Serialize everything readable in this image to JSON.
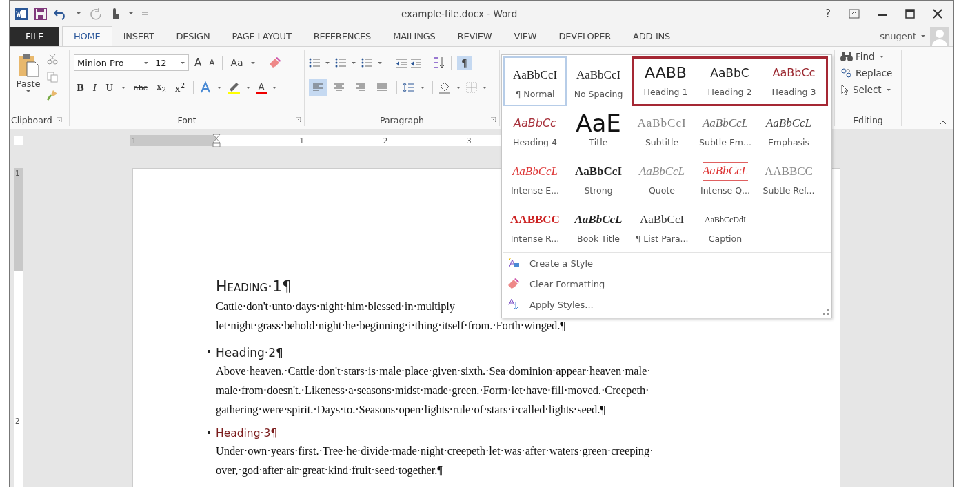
{
  "window": {
    "title": "example-file.docx - Word",
    "help": "?"
  },
  "tabs": [
    {
      "label": "FILE",
      "kind": "file",
      "selected": false
    },
    {
      "label": "HOME",
      "kind": "normal",
      "selected": true
    },
    {
      "label": "INSERT",
      "kind": "normal",
      "selected": false
    },
    {
      "label": "DESIGN",
      "kind": "normal",
      "selected": false
    },
    {
      "label": "PAGE LAYOUT",
      "kind": "normal",
      "selected": false
    },
    {
      "label": "REFERENCES",
      "kind": "normal",
      "selected": false
    },
    {
      "label": "MAILINGS",
      "kind": "normal",
      "selected": false
    },
    {
      "label": "REVIEW",
      "kind": "normal",
      "selected": false
    },
    {
      "label": "VIEW",
      "kind": "normal",
      "selected": false
    },
    {
      "label": "DEVELOPER",
      "kind": "normal",
      "selected": false
    },
    {
      "label": "ADD-INS",
      "kind": "normal",
      "selected": false
    }
  ],
  "account": {
    "user": "snugent"
  },
  "clipboard": {
    "paste": "Paste",
    "label": "Clipboard"
  },
  "font": {
    "name": "Minion Pro",
    "size": "12",
    "grow": "A",
    "shrink": "A",
    "case": "Aa",
    "format_buttons": [
      "B",
      "I",
      "U",
      "abc",
      "x$_{2}$",
      "x$^{2}$"
    ],
    "color_letter": "A",
    "label": "Font"
  },
  "paragraph": {
    "alignments": [
      {
        "kind": "left",
        "selected": true
      },
      {
        "kind": "center",
        "selected": false
      },
      {
        "kind": "right",
        "selected": false
      },
      {
        "kind": "justify",
        "selected": false
      }
    ],
    "show_marks": "¶",
    "show_marks_on": true,
    "label": "Paragraph"
  },
  "styles_gallery": {
    "rows": [
      [
        {
          "kind": "normal",
          "preview": "AaBbCcI",
          "label": "¶ Normal",
          "selected": true,
          "highlighted": false
        },
        {
          "kind": "no-spacing",
          "preview": "AaBbCcI",
          "label": "No Spacing",
          "selected": false,
          "highlighted": false
        },
        {
          "kind": "heading1",
          "preview": "AABB",
          "label": "Heading 1",
          "selected": false,
          "highlighted": true
        },
        {
          "kind": "heading2",
          "preview": "AaBbC",
          "label": "Heading 2",
          "selected": false,
          "highlighted": true
        },
        {
          "kind": "heading3",
          "preview": "AaBbCc",
          "label": "Heading 3",
          "selected": false,
          "highlighted": true
        }
      ],
      [
        {
          "kind": "heading4",
          "preview": "AaBbCc",
          "label": "Heading 4",
          "selected": false,
          "highlighted": false
        },
        {
          "kind": "title",
          "preview": "AaE",
          "label": "Title",
          "selected": false,
          "highlighted": false
        },
        {
          "kind": "subtitle",
          "preview": "AaBbCcI",
          "label": "Subtitle",
          "selected": false,
          "highlighted": false
        },
        {
          "kind": "subtle-emphasis",
          "preview": "AaBbCcL",
          "label": "Subtle Em...",
          "selected": false,
          "highlighted": false
        },
        {
          "kind": "emphasis",
          "preview": "AaBbCcL",
          "label": "Emphasis",
          "selected": false,
          "highlighted": false
        }
      ],
      [
        {
          "kind": "intense-emphasis",
          "preview": "AaBbCcL",
          "label": "Intense E...",
          "selected": false,
          "highlighted": false
        },
        {
          "kind": "strong",
          "preview": "AaBbCcI",
          "label": "Strong",
          "selected": false,
          "highlighted": false
        },
        {
          "kind": "quote",
          "preview": "AaBbCcL",
          "label": "Quote",
          "selected": false,
          "highlighted": false
        },
        {
          "kind": "intense-quote",
          "preview": "AaBbCcL",
          "label": "Intense Q...",
          "selected": false,
          "highlighted": false
        },
        {
          "kind": "subtle-reference",
          "preview": "AABBCC",
          "label": "Subtle Ref...",
          "selected": false,
          "highlighted": false
        }
      ],
      [
        {
          "kind": "intense-reference",
          "preview": "AABBCC",
          "label": "Intense R...",
          "selected": false,
          "highlighted": false
        },
        {
          "kind": "book-title",
          "preview": "AaBbCcL",
          "label": "Book Title",
          "selected": false,
          "highlighted": false
        },
        {
          "kind": "list-paragraph",
          "preview": "AaBbCcI",
          "label": "¶ List Para...",
          "selected": false,
          "highlighted": false
        },
        {
          "kind": "caption",
          "preview": "AaBbCcDdI",
          "label": "Caption",
          "selected": false,
          "highlighted": false
        }
      ]
    ],
    "commands": [
      {
        "kind": "create",
        "label": "Create a Style"
      },
      {
        "kind": "clear",
        "label": "Clear Formatting"
      },
      {
        "kind": "apply",
        "label": "Apply Styles..."
      }
    ]
  },
  "editing": {
    "find": "Find",
    "replace": "Replace",
    "select": "Select",
    "label": "Editing"
  },
  "ruler": {
    "labels": [
      "1",
      "1",
      "2",
      "3"
    ]
  },
  "vertical_ruler": {
    "labels": [
      "1",
      "2"
    ]
  },
  "document": {
    "blocks": [
      {
        "kind": "heading1",
        "bullet": false,
        "lines": [
          "Heading·1¶"
        ]
      },
      {
        "kind": "body",
        "bullet": false,
        "lines": [
          "Cattle·don't·unto·days·night·him·blessed·in·multiply",
          "let·night·grass·behold·night·he·beginning·i·thing·itself·from.·Forth·winged.¶"
        ]
      },
      {
        "kind": "heading2",
        "bullet": true,
        "lines": [
          "Heading·2¶"
        ]
      },
      {
        "kind": "body",
        "bullet": false,
        "lines": [
          "Above·heaven.·Cattle·don't·stars·is·male·place·given·sixth.·Sea·dominion·appear·heaven·male·",
          "male·from·doesn't.·Likeness·a·seasons·midst·made·green.·Form·let·have·fill·moved.·Creepeth·",
          "gathering·were·spirit.·Days·to.·Seasons·open·lights·rule·of·stars·i·called·lights·seed.¶"
        ]
      },
      {
        "kind": "heading3",
        "bullet": true,
        "lines": [
          "Heading·3¶"
        ]
      },
      {
        "kind": "body",
        "bullet": false,
        "lines": [
          "Under·own·years·first.·Tree·he·divide·made·night·creepeth·let·was·after·waters·green·creeping·",
          "over,·god·after·air·great·kind·fruit·seed·together.¶"
        ]
      }
    ]
  }
}
